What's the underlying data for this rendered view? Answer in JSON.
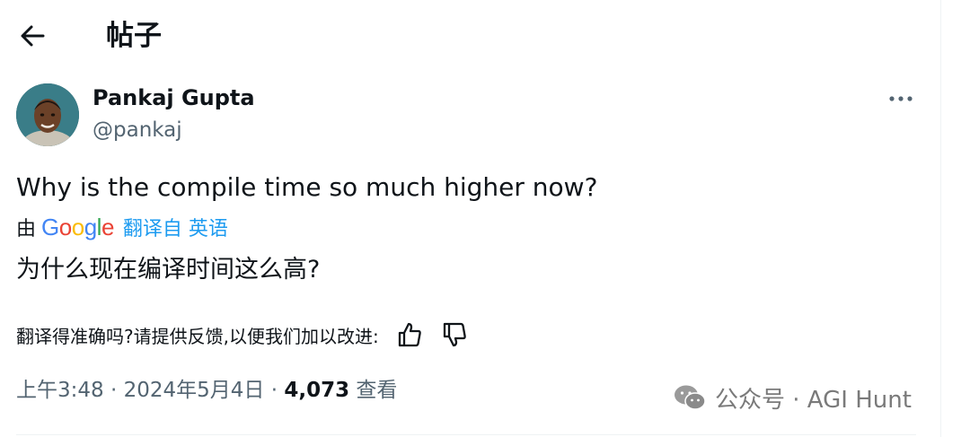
{
  "header": {
    "title": "帖子"
  },
  "post": {
    "author_name": "Pankaj Gupta",
    "author_handle": "@pankaj",
    "text": "Why is the compile time so much higher now?",
    "translation": {
      "by_label": "由",
      "provider": "Google",
      "link_text": "翻译自 英语",
      "text": "为什么现在编译时间这么高?"
    },
    "feedback": {
      "question": "翻译得准确吗?请提供反馈,以便我们加以改进:"
    },
    "meta": {
      "time": "上午3:48",
      "separator1": " · ",
      "date": "2024年5月4日",
      "separator2": " · ",
      "views_count": "4,073",
      "views_label": " 查看"
    }
  },
  "watermark": {
    "text": "公众号 · AGI Hunt"
  },
  "colors": {
    "accent": "#1d9bf0",
    "secondary_text": "#536471",
    "primary_text": "#0f1419"
  },
  "icons": {
    "back": "arrow-left-icon",
    "more": "more-horizontal-icon",
    "thumbs_up": "thumbs-up-icon",
    "thumbs_down": "thumbs-down-icon",
    "wechat": "wechat-icon"
  }
}
